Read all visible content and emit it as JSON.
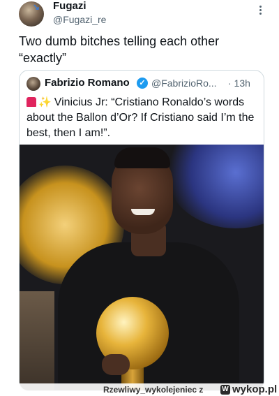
{
  "tweet": {
    "display_name": "Fugazi",
    "handle": "@Fugazi_re",
    "text": "Two dumb bitches telling each other “exactly”"
  },
  "quote": {
    "display_name": "Fabrizio Romano",
    "handle": "@FabrizioRo...",
    "separator_time": "· 13h",
    "text": "Vinicius Jr: “Cristiano Ronaldo’s words about the Ballon d’Or? If Cristiano said I’m the best, then I am!”.",
    "verified_icon": "check-badge",
    "emoji_1": "police-siren",
    "emoji_2": "sparkles"
  },
  "watermark": {
    "user": "Rzewliwy_wykolejeniec",
    "separator": "z",
    "site": "wykop.pl",
    "logo_letter": "W"
  },
  "colors": {
    "accent": "#1d9bf0",
    "text": "#0f1419",
    "secondary": "#536471",
    "border": "#cfd9de"
  }
}
